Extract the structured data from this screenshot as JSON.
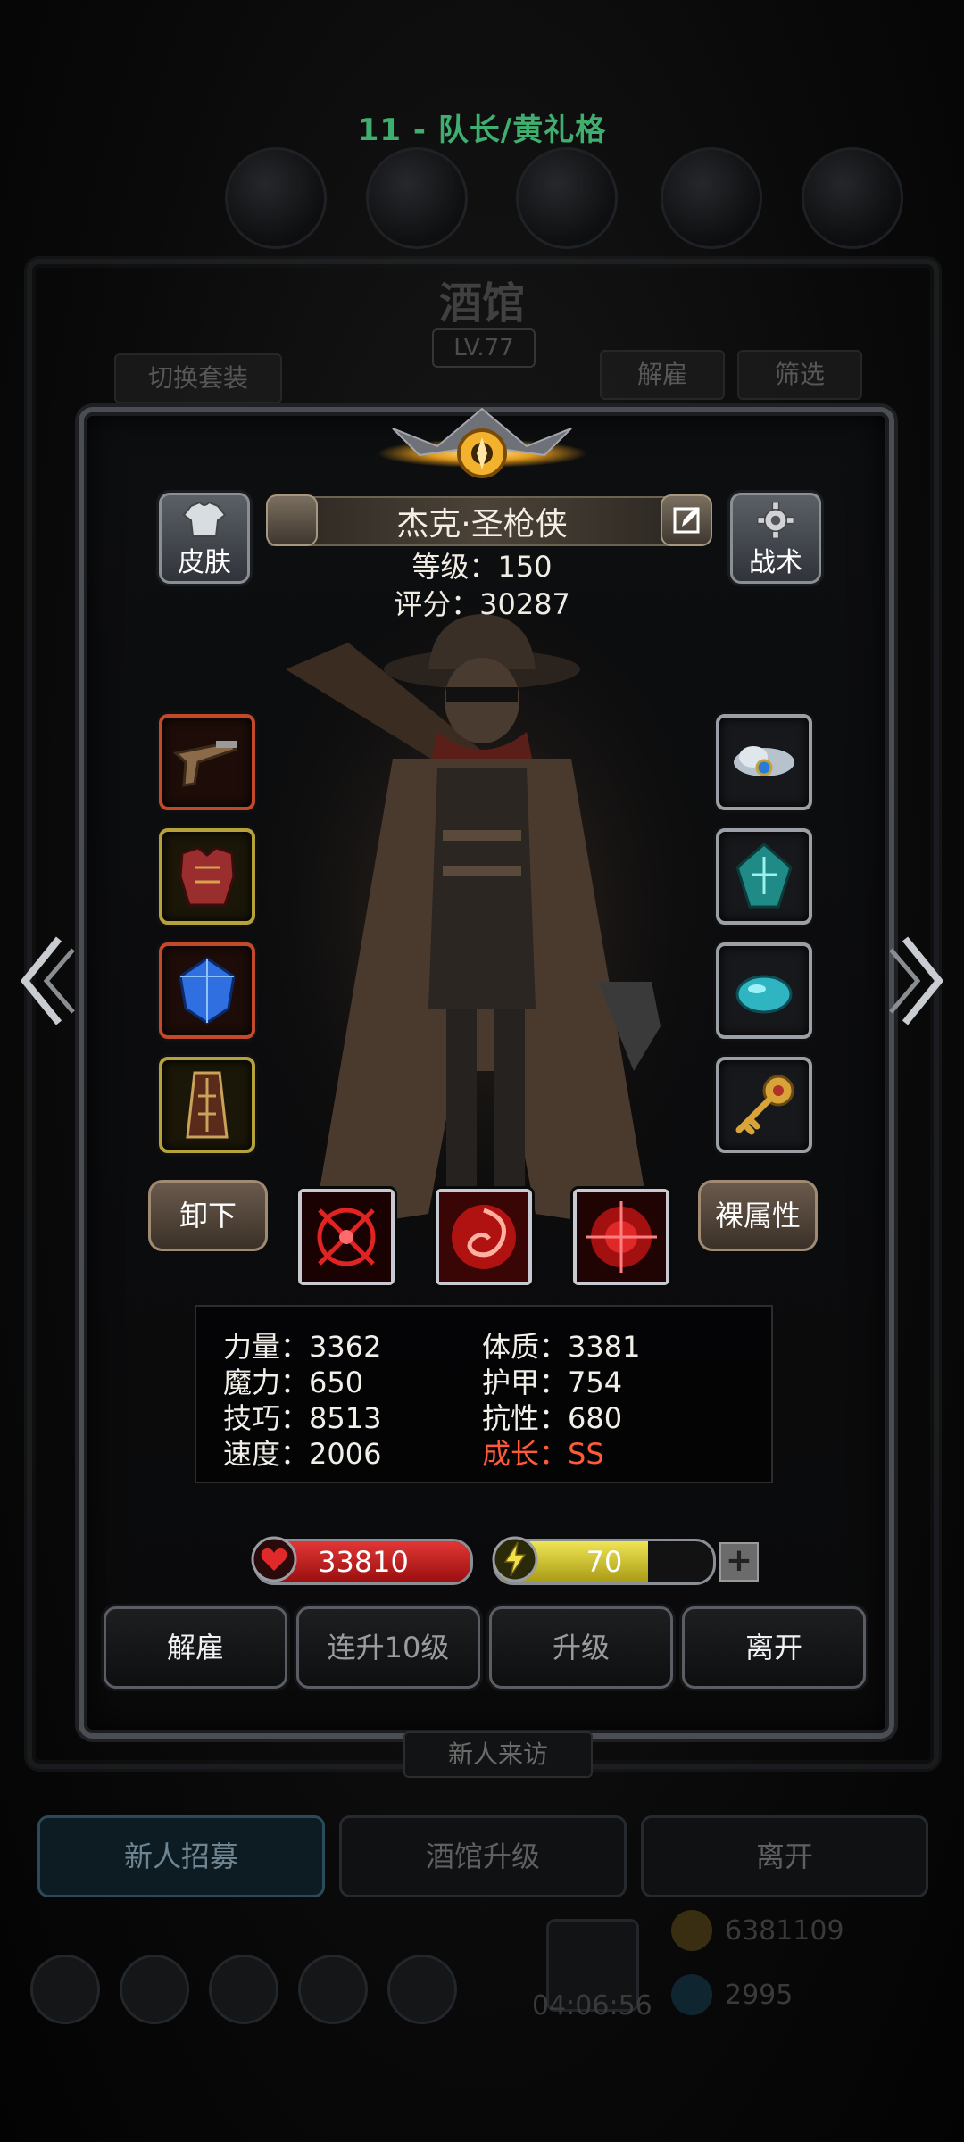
{
  "header": {
    "party_title": "11 - 队长/黄礼格"
  },
  "background": {
    "tavern_sign": "酒馆",
    "tavern_level": "LV.77",
    "switch_outfit": "切换套装",
    "dismiss": "解雇",
    "filter": "筛选",
    "new_visitor": "新人来访",
    "timer": "04:06:56",
    "gold": "6381109",
    "gems": "2995"
  },
  "hero": {
    "name": "杰克·圣枪侠",
    "level_line": "等级：150",
    "score_line": "评分：30287",
    "skin_label": "皮肤",
    "tactics_label": "战术"
  },
  "equipment": {
    "left": [
      "flintlock-pistol",
      "red-chest-armor",
      "blue-crystal-gem",
      "ornate-bracer"
    ],
    "right": [
      "cloud-ring",
      "teal-rune-stone",
      "teal-pebble",
      "golden-key"
    ]
  },
  "controls": {
    "unequip_label": "卸下",
    "base_attr_label": "裸属性"
  },
  "skills": [
    "crosshair-burst",
    "crimson-vortex",
    "red-target"
  ],
  "stats": {
    "strength": "力量：3362",
    "magic": "魔力：650",
    "skill": "技巧：8513",
    "speed": "速度：2006",
    "constitution": "体质：3381",
    "armor": "护甲：754",
    "resistance": "抗性：680",
    "growth": "成长：SS"
  },
  "vitals": {
    "hp_value": "33810",
    "energy_value": "70",
    "energy_fraction": 0.7,
    "plus": "+"
  },
  "actions": {
    "dismiss": "解雇",
    "level_up_10": "连升10级",
    "upgrade": "升级",
    "leave": "离开"
  },
  "bottom_nav": {
    "recruit": "新人招募",
    "tavern_upgrade": "酒馆升级",
    "leave": "离开"
  },
  "colors": {
    "party_title": "#3fae6e",
    "growth": "#ff5a3a",
    "hp_fill": "#d62a2a",
    "energy_fill": "#e0d540"
  }
}
